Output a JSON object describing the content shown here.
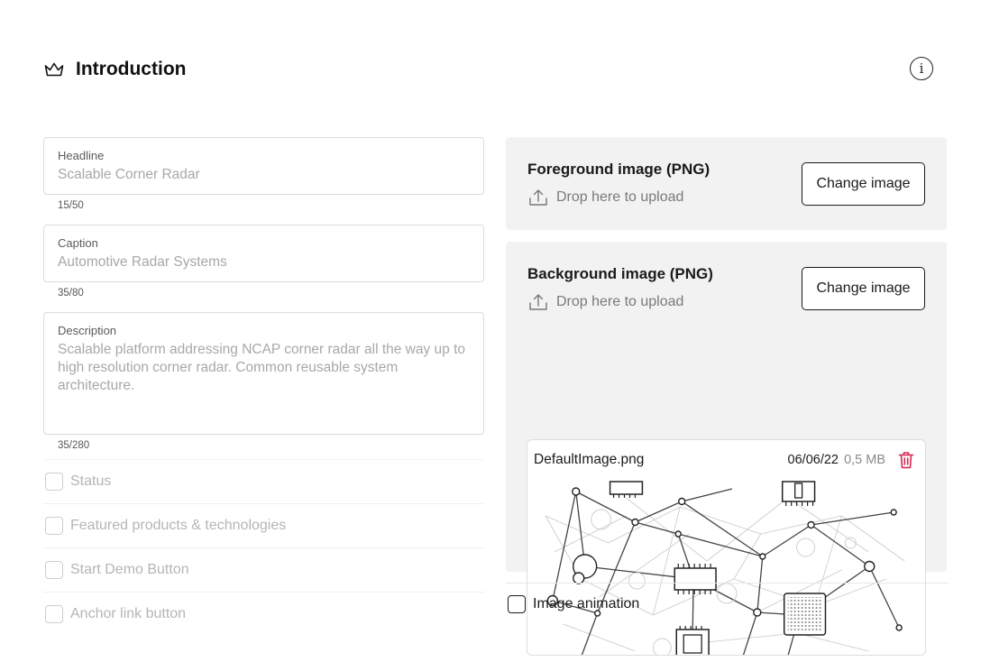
{
  "header": {
    "title": "Introduction",
    "info_symbol": "i"
  },
  "form": {
    "headline": {
      "label": "Headline",
      "value": "Scalable Corner Radar",
      "counter": "15/50"
    },
    "caption": {
      "label": "Caption",
      "value": "Automotive Radar Systems",
      "counter": "35/80"
    },
    "description": {
      "label": "Description",
      "value": "Scalable platform addressing NCAP corner radar all the way up to high resolution corner radar. Common reusable system architecture.",
      "counter": "35/280"
    },
    "checkboxes": [
      {
        "label": "Status",
        "checked": false
      },
      {
        "label": "Featured products & technologies",
        "checked": false
      },
      {
        "label": "Start Demo Button",
        "checked": false
      },
      {
        "label": "Anchor link button",
        "checked": false
      }
    ]
  },
  "foreground": {
    "title": "Foreground image (PNG)",
    "drop_text": "Drop here to upload",
    "button_label": "Change image"
  },
  "background": {
    "title": "Background image (PNG)",
    "drop_text": "Drop here to upload",
    "button_label": "Change image",
    "file": {
      "name": "DefaultImage.png",
      "date": "06/06/22",
      "size": "0,5 MB"
    }
  },
  "image_animation": {
    "label": "Image animation",
    "checked": false
  },
  "colors": {
    "delete": "#d6264f",
    "panel": "#f2f2f2",
    "border": "#dcdcdc"
  },
  "icons": {
    "header": "crown-icon",
    "info": "info-icon",
    "upload": "upload-icon",
    "delete": "trash-icon"
  }
}
